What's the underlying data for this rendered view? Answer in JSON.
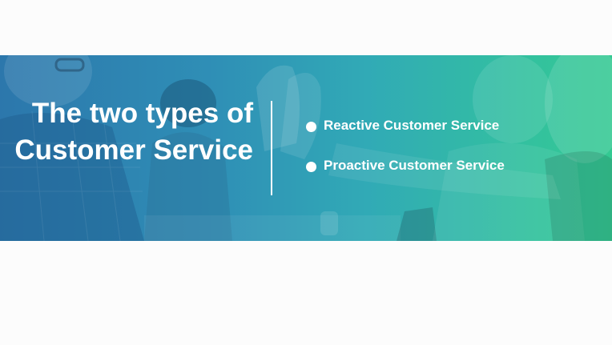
{
  "banner": {
    "title": "The two types of Customer Service",
    "items": [
      {
        "label": "Reactive Customer Service"
      },
      {
        "label": "Proactive Customer Service"
      }
    ]
  },
  "colors": {
    "gradient_start": "#2c77ac",
    "gradient_end": "#34c992",
    "text": "#ffffff",
    "page_background": "#fcfcfc"
  },
  "background_image": {
    "icon": "people-high-five-photo"
  }
}
